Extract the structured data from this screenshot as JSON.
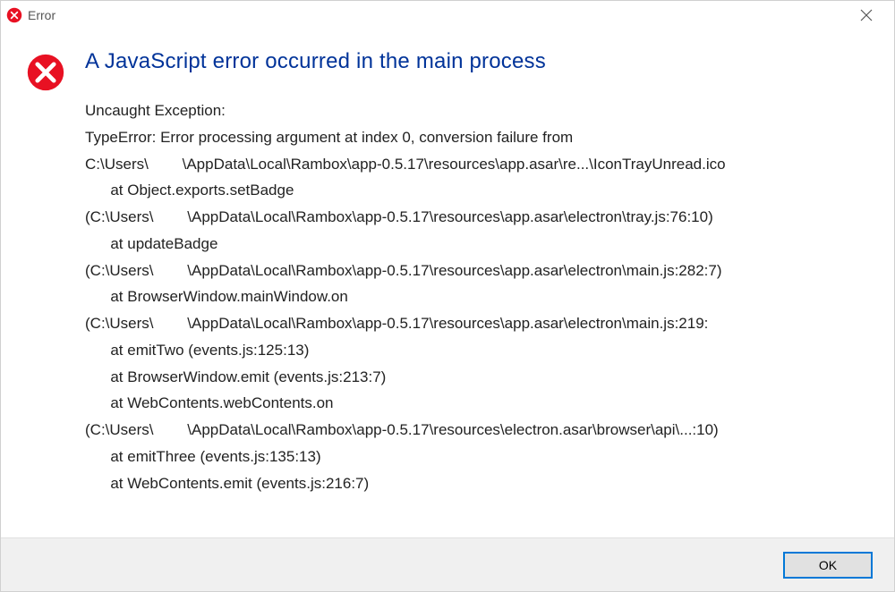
{
  "titlebar": {
    "title": "Error"
  },
  "dialog": {
    "headline": "A JavaScript error occurred in the main process",
    "stack": "Uncaught Exception:\nTypeError: Error processing argument at index 0, conversion failure from\nC:\\Users\\        \\AppData\\Local\\Rambox\\app-0.5.17\\resources\\app.asar\\re...\\IconTrayUnread.ico\n      at Object.exports.setBadge\n(C:\\Users\\        \\AppData\\Local\\Rambox\\app-0.5.17\\resources\\app.asar\\electron\\tray.js:76:10)\n      at updateBadge\n(C:\\Users\\        \\AppData\\Local\\Rambox\\app-0.5.17\\resources\\app.asar\\electron\\main.js:282:7)\n      at BrowserWindow.mainWindow.on\n(C:\\Users\\        \\AppData\\Local\\Rambox\\app-0.5.17\\resources\\app.asar\\electron\\main.js:219:\n      at emitTwo (events.js:125:13)\n      at BrowserWindow.emit (events.js:213:7)\n      at WebContents.webContents.on\n(C:\\Users\\        \\AppData\\Local\\Rambox\\app-0.5.17\\resources\\electron.asar\\browser\\api\\...:10)\n      at emitThree (events.js:135:13)\n      at WebContents.emit (events.js:216:7)"
  },
  "footer": {
    "ok_label": "OK"
  }
}
